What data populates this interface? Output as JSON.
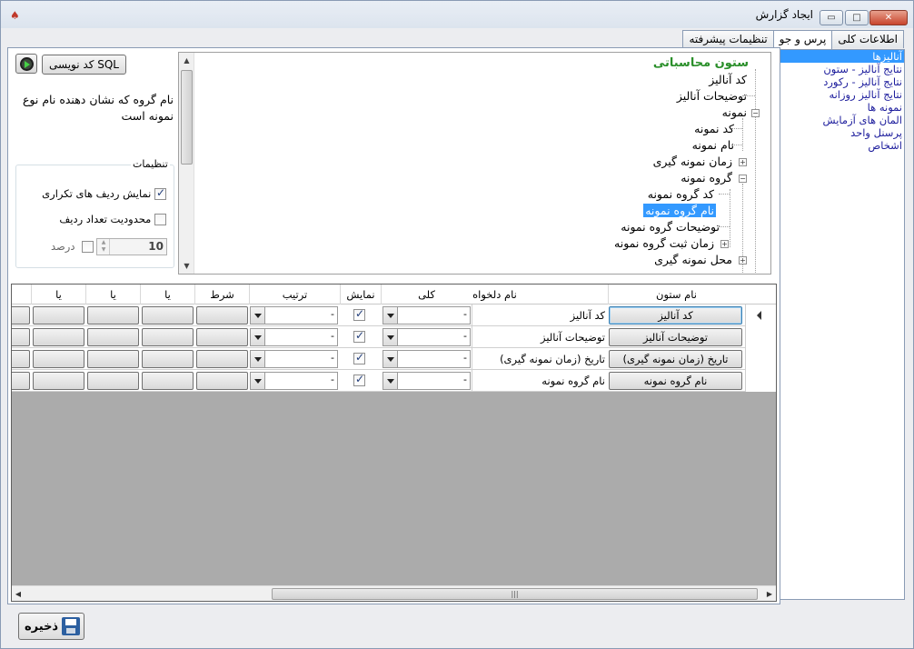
{
  "window": {
    "title": "ایجاد گزارش",
    "app_icon": "report-icon",
    "min_glyph": "▭",
    "max_glyph": "□",
    "close_glyph": "✕"
  },
  "tabs": [
    {
      "label": "اطلاعات کلی",
      "active": false
    },
    {
      "label": "پرس و جو",
      "active": true
    },
    {
      "label": "تنظیمات پیشرفته",
      "active": false
    }
  ],
  "right_list": {
    "items": [
      "آنالیزها",
      "نتایج آنالیز - ستون",
      "نتایج آنالیز - رکورد",
      "نتایج آنالیز روزانه",
      "نمونه ها",
      "المان های آزمایش",
      "پرسنل واحد",
      "اشخاص"
    ],
    "selected_index": 0
  },
  "toolbar": {
    "sql_label": "کد نویسی SQL",
    "run_icon": "gear-play-icon"
  },
  "description": "نام گروه که نشان دهنده نام نوع نمونه است",
  "settings": {
    "legend": "تنظیمات",
    "show_duplicate_rows_label": "نمایش ردیف های تکراری",
    "show_duplicate_rows": true,
    "limit_rows_label": "محدودیت تعداد ردیف",
    "limit_rows": false,
    "limit_value": "10",
    "percent_label": "درصد",
    "percent": false
  },
  "tree": {
    "root": "ستون محاسباتی",
    "nodes": [
      {
        "label": "کد آنالیز"
      },
      {
        "label": "توضیحات آنالیز"
      },
      {
        "label": "نمونه",
        "expander": "−"
      },
      {
        "label": "کد نمونه"
      },
      {
        "label": "نام نمونه"
      },
      {
        "label": "زمان نمونه گیری",
        "expander": "+"
      },
      {
        "label": "گروه نمونه",
        "expander": "−"
      },
      {
        "label": "کد گروه نمونه"
      },
      {
        "label": "نام گروه نمونه",
        "selected": true
      },
      {
        "label": "توضیحات گروه نمونه"
      },
      {
        "label": "زمان ثبت گروه نمونه",
        "expander": "+"
      },
      {
        "label": "محل نمونه گیری",
        "expander": "+"
      }
    ]
  },
  "grid": {
    "columns": [
      "نام ستون",
      "نام دلخواه",
      "کلی",
      "نمایش",
      "ترتیب",
      "شرط",
      "یا",
      "یا",
      "یا"
    ],
    "rows": [
      {
        "column": "کد آنالیز",
        "alias": "کد آنالیز",
        "aggregate": "-",
        "show": true,
        "order": "-"
      },
      {
        "column": "توضیحات آنالیز",
        "alias": "توضیحات آنالیز",
        "aggregate": "-",
        "show": true,
        "order": "-"
      },
      {
        "column": "تاریخ (زمان نمونه گیری)",
        "alias": "تاریخ (زمان نمونه گیری)",
        "aggregate": "-",
        "show": true,
        "order": "-"
      },
      {
        "column": "نام گروه نمونه",
        "alias": "نام گروه نمونه",
        "aggregate": "-",
        "show": true,
        "order": "-"
      }
    ],
    "current_row": 0,
    "hscroll_grip": "|||"
  },
  "save": {
    "label": "ذخیره",
    "icon": "floppy-disk-icon"
  }
}
